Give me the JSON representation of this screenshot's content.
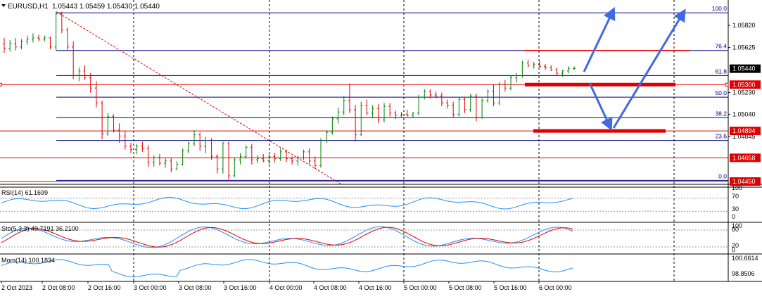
{
  "header": {
    "symbol_label": "EURUSD,H1",
    "ohlc_label": "1.05443 1.05459 1.05430 1.05440",
    "dropdown_icon": "triangle-down-icon"
  },
  "colors": {
    "bull": "#008000",
    "bear": "#e00000",
    "fib": "#000080",
    "hline": "#e00000",
    "trend": "#e00000",
    "arrow": "#4169e1",
    "indicator": "#1e90ff",
    "sto_signal": "#e00000",
    "price_tag": "#000000",
    "level_tag": "#e00000"
  },
  "price_axis": {
    "ticks": [
      "1.05820",
      "1.05625",
      "1.05230",
      "1.05040",
      "1.04845"
    ],
    "current_price_tag": "1.05440",
    "level_tags": [
      "1.05300",
      "1.04894",
      "1.04658",
      "1.04450"
    ]
  },
  "fibonacci": {
    "labels": [
      "100.0",
      "76.4",
      "61.8",
      "50.0",
      "38.2",
      "23.6",
      "0.0"
    ]
  },
  "indicators": {
    "rsi": {
      "label": "RSI(14) 61.1699",
      "ticks": [
        "100",
        "70",
        "30",
        "0"
      ]
    },
    "sto": {
      "label": "Sto(5,3,3) 49.7191 36.2100",
      "ticks": [
        "100",
        "80",
        "20",
        "0"
      ]
    },
    "mom": {
      "label": "Mom(14) 100.1834",
      "ticks": [
        "100.6614",
        "98.8506"
      ]
    }
  },
  "time_axis": {
    "labels": [
      "2 Oct 2023",
      "2 Oct 08:00",
      "2 Oct 16:00",
      "3 Oct 00:00",
      "3 Oct 08:00",
      "3 Oct 16:00",
      "4 Oct 00:00",
      "4 Oct 08:00",
      "4 Oct 16:00",
      "5 Oct 00:00",
      "5 Oct 08:00",
      "5 Oct 16:00",
      "6 Oct 00:00"
    ]
  },
  "chart_data": {
    "type": "candlestick",
    "symbol": "EURUSD",
    "timeframe": "H1",
    "ylim": [
      1.0445,
      1.0595
    ],
    "x_labels": [
      "2 Oct 2023",
      "2 Oct 08:00",
      "2 Oct 16:00",
      "3 Oct 00:00",
      "3 Oct 08:00",
      "3 Oct 16:00",
      "4 Oct 00:00",
      "4 Oct 08:00",
      "4 Oct 16:00",
      "5 Oct 00:00",
      "5 Oct 08:00",
      "5 Oct 16:00",
      "6 Oct 00:00"
    ],
    "fib_levels": [
      {
        "label": "100.0",
        "price": 1.0593
      },
      {
        "label": "76.4",
        "price": 1.056
      },
      {
        "label": "61.8",
        "price": 1.0538
      },
      {
        "label": "50.0",
        "price": 1.0519
      },
      {
        "label": "38.2",
        "price": 1.0501
      },
      {
        "label": "23.6",
        "price": 1.0481
      },
      {
        "label": "0.0",
        "price": 1.0446
      }
    ],
    "horizontal_levels": [
      1.053,
      1.04894,
      1.04658,
      1.0445
    ],
    "current_price": 1.0544,
    "candles": [
      {
        "o": 1.0566,
        "h": 1.0571,
        "l": 1.0558,
        "c": 1.0562
      },
      {
        "o": 1.0562,
        "h": 1.0569,
        "l": 1.0559,
        "c": 1.0566
      },
      {
        "o": 1.0566,
        "h": 1.0571,
        "l": 1.056,
        "c": 1.0563
      },
      {
        "o": 1.0563,
        "h": 1.057,
        "l": 1.0561,
        "c": 1.0568
      },
      {
        "o": 1.0568,
        "h": 1.0573,
        "l": 1.0565,
        "c": 1.057
      },
      {
        "o": 1.057,
        "h": 1.0575,
        "l": 1.0567,
        "c": 1.0571
      },
      {
        "o": 1.0571,
        "h": 1.0574,
        "l": 1.0568,
        "c": 1.057
      },
      {
        "o": 1.057,
        "h": 1.0573,
        "l": 1.0568,
        "c": 1.0571
      },
      {
        "o": 1.0571,
        "h": 1.0572,
        "l": 1.0561,
        "c": 1.0563
      },
      {
        "o": 1.0563,
        "h": 1.0594,
        "l": 1.056,
        "c": 1.0592
      },
      {
        "o": 1.0592,
        "h": 1.0594,
        "l": 1.0575,
        "c": 1.0578
      },
      {
        "o": 1.0578,
        "h": 1.058,
        "l": 1.056,
        "c": 1.0563
      },
      {
        "o": 1.0563,
        "h": 1.0568,
        "l": 1.0535,
        "c": 1.0538
      },
      {
        "o": 1.0538,
        "h": 1.0545,
        "l": 1.0533,
        "c": 1.0542
      },
      {
        "o": 1.0542,
        "h": 1.0547,
        "l": 1.0534,
        "c": 1.0536
      },
      {
        "o": 1.0536,
        "h": 1.054,
        "l": 1.0523,
        "c": 1.0527
      },
      {
        "o": 1.0527,
        "h": 1.0533,
        "l": 1.051,
        "c": 1.0514
      },
      {
        "o": 1.0514,
        "h": 1.0516,
        "l": 1.0482,
        "c": 1.0487
      },
      {
        "o": 1.0487,
        "h": 1.0505,
        "l": 1.0485,
        "c": 1.0502
      },
      {
        "o": 1.0502,
        "h": 1.0504,
        "l": 1.0488,
        "c": 1.049
      },
      {
        "o": 1.049,
        "h": 1.0496,
        "l": 1.0479,
        "c": 1.0485
      },
      {
        "o": 1.0485,
        "h": 1.0489,
        "l": 1.0473,
        "c": 1.0476
      },
      {
        "o": 1.0476,
        "h": 1.0479,
        "l": 1.047,
        "c": 1.0473
      },
      {
        "o": 1.0473,
        "h": 1.0478,
        "l": 1.0469,
        "c": 1.0476
      },
      {
        "o": 1.0476,
        "h": 1.048,
        "l": 1.0471,
        "c": 1.0474
      },
      {
        "o": 1.0474,
        "h": 1.0477,
        "l": 1.0458,
        "c": 1.0462
      },
      {
        "o": 1.0462,
        "h": 1.0468,
        "l": 1.0458,
        "c": 1.0466
      },
      {
        "o": 1.0466,
        "h": 1.0469,
        "l": 1.0459,
        "c": 1.0461
      },
      {
        "o": 1.0461,
        "h": 1.0466,
        "l": 1.0457,
        "c": 1.0463
      },
      {
        "o": 1.0463,
        "h": 1.0466,
        "l": 1.0453,
        "c": 1.0456
      },
      {
        "o": 1.0456,
        "h": 1.0463,
        "l": 1.0455,
        "c": 1.046
      },
      {
        "o": 1.046,
        "h": 1.0474,
        "l": 1.0459,
        "c": 1.0472
      },
      {
        "o": 1.0472,
        "h": 1.048,
        "l": 1.047,
        "c": 1.0478
      },
      {
        "o": 1.0478,
        "h": 1.049,
        "l": 1.0476,
        "c": 1.0486
      },
      {
        "o": 1.0486,
        "h": 1.0488,
        "l": 1.0472,
        "c": 1.0476
      },
      {
        "o": 1.0476,
        "h": 1.0484,
        "l": 1.047,
        "c": 1.0481
      },
      {
        "o": 1.0481,
        "h": 1.0483,
        "l": 1.0464,
        "c": 1.0467
      },
      {
        "o": 1.0467,
        "h": 1.0469,
        "l": 1.0452,
        "c": 1.0456
      },
      {
        "o": 1.0456,
        "h": 1.048,
        "l": 1.0452,
        "c": 1.0478
      },
      {
        "o": 1.0478,
        "h": 1.048,
        "l": 1.0446,
        "c": 1.045
      },
      {
        "o": 1.045,
        "h": 1.0466,
        "l": 1.0449,
        "c": 1.0464
      },
      {
        "o": 1.0464,
        "h": 1.047,
        "l": 1.046,
        "c": 1.0467
      },
      {
        "o": 1.0467,
        "h": 1.0477,
        "l": 1.0465,
        "c": 1.0475
      },
      {
        "o": 1.0475,
        "h": 1.0478,
        "l": 1.046,
        "c": 1.0464
      },
      {
        "o": 1.0464,
        "h": 1.0468,
        "l": 1.0461,
        "c": 1.0465
      },
      {
        "o": 1.0465,
        "h": 1.0469,
        "l": 1.0462,
        "c": 1.0463
      },
      {
        "o": 1.0463,
        "h": 1.0469,
        "l": 1.046,
        "c": 1.0467
      },
      {
        "o": 1.0467,
        "h": 1.047,
        "l": 1.0462,
        "c": 1.0465
      },
      {
        "o": 1.0465,
        "h": 1.0474,
        "l": 1.0463,
        "c": 1.0471
      },
      {
        "o": 1.0471,
        "h": 1.0473,
        "l": 1.0462,
        "c": 1.0465
      },
      {
        "o": 1.0465,
        "h": 1.0467,
        "l": 1.046,
        "c": 1.0463
      },
      {
        "o": 1.0463,
        "h": 1.0468,
        "l": 1.0459,
        "c": 1.0466
      },
      {
        "o": 1.0466,
        "h": 1.0473,
        "l": 1.0464,
        "c": 1.0471
      },
      {
        "o": 1.0471,
        "h": 1.0474,
        "l": 1.046,
        "c": 1.0463
      },
      {
        "o": 1.0463,
        "h": 1.0467,
        "l": 1.0456,
        "c": 1.0459
      },
      {
        "o": 1.0459,
        "h": 1.0483,
        "l": 1.0457,
        "c": 1.0481
      },
      {
        "o": 1.0481,
        "h": 1.049,
        "l": 1.0479,
        "c": 1.0488
      },
      {
        "o": 1.0488,
        "h": 1.0502,
        "l": 1.0486,
        "c": 1.05
      },
      {
        "o": 1.05,
        "h": 1.051,
        "l": 1.0496,
        "c": 1.0506
      },
      {
        "o": 1.0506,
        "h": 1.052,
        "l": 1.0503,
        "c": 1.0516
      },
      {
        "o": 1.0516,
        "h": 1.0531,
        "l": 1.0505,
        "c": 1.0508
      },
      {
        "o": 1.0508,
        "h": 1.0512,
        "l": 1.048,
        "c": 1.0486
      },
      {
        "o": 1.0486,
        "h": 1.0515,
        "l": 1.0485,
        "c": 1.0512
      },
      {
        "o": 1.0512,
        "h": 1.0517,
        "l": 1.0503,
        "c": 1.0505
      },
      {
        "o": 1.0505,
        "h": 1.0512,
        "l": 1.0501,
        "c": 1.0509
      },
      {
        "o": 1.0509,
        "h": 1.0513,
        "l": 1.0496,
        "c": 1.0499
      },
      {
        "o": 1.0499,
        "h": 1.0514,
        "l": 1.0497,
        "c": 1.0511
      },
      {
        "o": 1.0511,
        "h": 1.0514,
        "l": 1.0502,
        "c": 1.0505
      },
      {
        "o": 1.0505,
        "h": 1.0507,
        "l": 1.05,
        "c": 1.0503
      },
      {
        "o": 1.0503,
        "h": 1.0506,
        "l": 1.0501,
        "c": 1.0504
      },
      {
        "o": 1.0504,
        "h": 1.0508,
        "l": 1.0502,
        "c": 1.0503
      },
      {
        "o": 1.0503,
        "h": 1.0506,
        "l": 1.0501,
        "c": 1.0505
      },
      {
        "o": 1.0505,
        "h": 1.0521,
        "l": 1.0503,
        "c": 1.0519
      },
      {
        "o": 1.0519,
        "h": 1.0526,
        "l": 1.0517,
        "c": 1.0524
      },
      {
        "o": 1.0524,
        "h": 1.0526,
        "l": 1.0518,
        "c": 1.0521
      },
      {
        "o": 1.0521,
        "h": 1.0524,
        "l": 1.0518,
        "c": 1.052
      },
      {
        "o": 1.052,
        "h": 1.0523,
        "l": 1.0511,
        "c": 1.0514
      },
      {
        "o": 1.0514,
        "h": 1.0517,
        "l": 1.0509,
        "c": 1.0512
      },
      {
        "o": 1.0512,
        "h": 1.0515,
        "l": 1.0501,
        "c": 1.0504
      },
      {
        "o": 1.0504,
        "h": 1.0519,
        "l": 1.0502,
        "c": 1.0517
      },
      {
        "o": 1.0517,
        "h": 1.0519,
        "l": 1.0505,
        "c": 1.0508
      },
      {
        "o": 1.0508,
        "h": 1.0522,
        "l": 1.0506,
        "c": 1.052
      },
      {
        "o": 1.052,
        "h": 1.0522,
        "l": 1.0498,
        "c": 1.0501
      },
      {
        "o": 1.0501,
        "h": 1.0518,
        "l": 1.05,
        "c": 1.0516
      },
      {
        "o": 1.0516,
        "h": 1.0526,
        "l": 1.0514,
        "c": 1.0524
      },
      {
        "o": 1.0524,
        "h": 1.053,
        "l": 1.0511,
        "c": 1.0514
      },
      {
        "o": 1.0514,
        "h": 1.0532,
        "l": 1.0512,
        "c": 1.053
      },
      {
        "o": 1.053,
        "h": 1.0534,
        "l": 1.0524,
        "c": 1.0527
      },
      {
        "o": 1.0527,
        "h": 1.0538,
        "l": 1.0525,
        "c": 1.0536
      },
      {
        "o": 1.0536,
        "h": 1.054,
        "l": 1.0532,
        "c": 1.0538
      },
      {
        "o": 1.0538,
        "h": 1.0551,
        "l": 1.0536,
        "c": 1.0549
      },
      {
        "o": 1.0549,
        "h": 1.0552,
        "l": 1.0545,
        "c": 1.0547
      },
      {
        "o": 1.0547,
        "h": 1.055,
        "l": 1.0544,
        "c": 1.0548
      },
      {
        "o": 1.0548,
        "h": 1.0551,
        "l": 1.0545,
        "c": 1.0546
      },
      {
        "o": 1.0546,
        "h": 1.0548,
        "l": 1.0543,
        "c": 1.0545
      },
      {
        "o": 1.0545,
        "h": 1.0547,
        "l": 1.0542,
        "c": 1.0543
      },
      {
        "o": 1.0543,
        "h": 1.0545,
        "l": 1.0538,
        "c": 1.054
      },
      {
        "o": 1.054,
        "h": 1.0543,
        "l": 1.0537,
        "c": 1.0542
      },
      {
        "o": 1.0542,
        "h": 1.0546,
        "l": 1.054,
        "c": 1.0544
      },
      {
        "o": 1.0544,
        "h": 1.0546,
        "l": 1.0543,
        "c": 1.0544
      }
    ]
  }
}
